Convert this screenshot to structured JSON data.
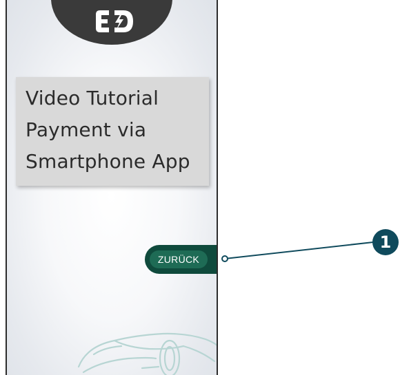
{
  "logo": {
    "icon": "ed-charging-logo-icon"
  },
  "title_card": {
    "lines": [
      "Video Tutorial",
      "Payment via",
      "Smartphone App"
    ]
  },
  "back_button": {
    "label": "ZURÜCK"
  },
  "decoration": {
    "icon": "car-outline-icon"
  },
  "callout": {
    "number": "1"
  },
  "colors": {
    "brand_green": "#0f4a3c",
    "button_pill": "#1e6b55",
    "callout_blue": "#0f4a5c",
    "logo_dome": "#3a3a3a",
    "card": "#d9d9d9"
  }
}
